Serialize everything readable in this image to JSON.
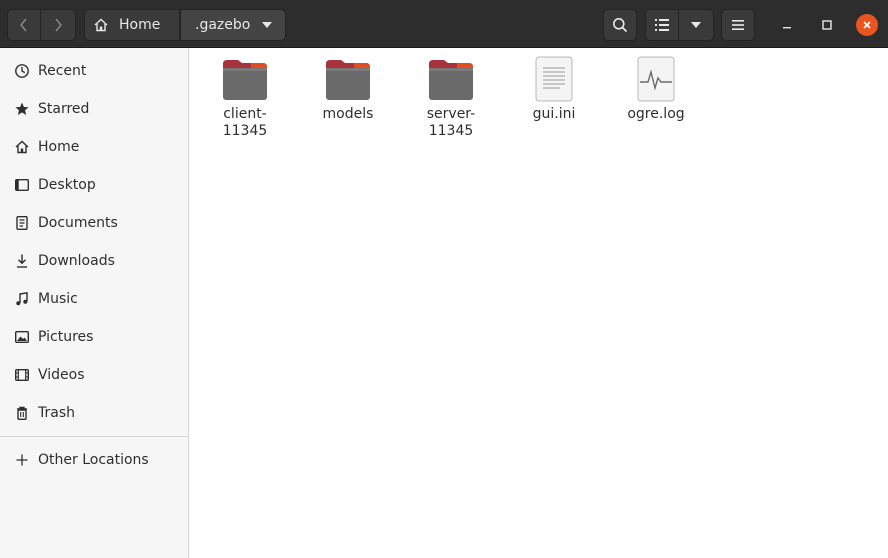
{
  "header": {
    "breadcrumb": {
      "home_label": "Home",
      "current_label": ".gazebo"
    },
    "buttons": {
      "back": "go-back",
      "forward": "go-forward",
      "search": "search-icon",
      "view": "list-view-icon",
      "view_options": "chevron-down-icon",
      "menu": "hamburger-menu-icon"
    },
    "accent_color": "#e95420"
  },
  "sidebar": {
    "items": [
      {
        "label": "Recent",
        "icon": "clock-icon"
      },
      {
        "label": "Starred",
        "icon": "star-icon"
      },
      {
        "label": "Home",
        "icon": "home-icon"
      },
      {
        "label": "Desktop",
        "icon": "desktop-icon"
      },
      {
        "label": "Documents",
        "icon": "document-icon"
      },
      {
        "label": "Downloads",
        "icon": "download-icon"
      },
      {
        "label": "Music",
        "icon": "music-icon"
      },
      {
        "label": "Pictures",
        "icon": "picture-icon"
      },
      {
        "label": "Videos",
        "icon": "video-icon"
      },
      {
        "label": "Trash",
        "icon": "trash-icon"
      }
    ],
    "other_locations": {
      "label": "Other Locations",
      "icon": "plus-icon"
    }
  },
  "files": [
    {
      "name": "client-11345",
      "name_lines": [
        "client-",
        "11345"
      ],
      "type": "folder"
    },
    {
      "name": "models",
      "name_lines": [
        "models"
      ],
      "type": "folder"
    },
    {
      "name": "server-11345",
      "name_lines": [
        "server-",
        "11345"
      ],
      "type": "folder"
    },
    {
      "name": "gui.ini",
      "name_lines": [
        "gui.ini"
      ],
      "type": "text-file"
    },
    {
      "name": "ogre.log",
      "name_lines": [
        "ogre.log"
      ],
      "type": "log-file"
    }
  ]
}
